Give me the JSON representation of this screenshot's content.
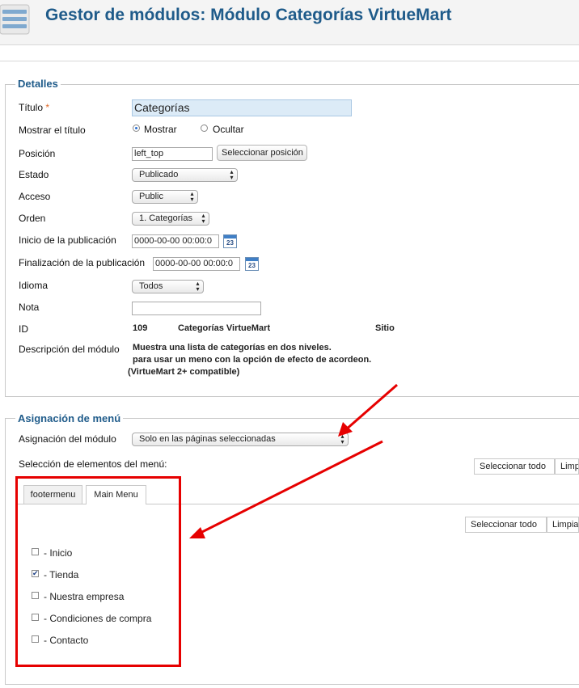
{
  "header": {
    "title": "Gestor de módulos: Módulo Categorías VirtueMart",
    "icon": "module-manager-icon"
  },
  "details": {
    "legend": "Detalles",
    "title_label": "Título",
    "required_mark": "*",
    "title_value": "Categorías",
    "show_title_label": "Mostrar el título",
    "show_title_options": [
      "Mostrar",
      "Ocultar"
    ],
    "show_title_selected": "Mostrar",
    "position_label": "Posición",
    "position_value": "left_top",
    "select_position_button": "Seleccionar posición",
    "status_label": "Estado",
    "status_value": "Publicado",
    "access_label": "Acceso",
    "access_value": "Public",
    "order_label": "Orden",
    "order_value": "1. Categorías",
    "publish_up_label": "Inicio de la publicación",
    "publish_up_value": "0000-00-00 00:00:0",
    "publish_down_label": "Finalización de la publicación",
    "publish_down_value": "0000-00-00 00:00:0",
    "calendar_day": "23",
    "language_label": "Idioma",
    "language_value": "Todos",
    "note_label": "Nota",
    "note_value": "",
    "id_label": "ID",
    "id_value": "109",
    "module_name": "Categorías VirtueMart",
    "module_site": "Sitio",
    "description_label": "Descripción del módulo",
    "description_lines": [
      "Muestra una lista de categorías en dos niveles.",
      "para usar un meno con la opción de efecto de acordeon.",
      "(VirtueMart 2+ compatible)"
    ]
  },
  "menu_assignment": {
    "legend": "Asignación de menú",
    "assignment_label": "Asignación del módulo",
    "assignment_value": "Solo en las páginas seleccionadas",
    "selection_label": "Selección de elementos del menú:",
    "select_all": "Seleccionar todo",
    "clear": "Limpiar",
    "tabs": [
      "footermenu",
      "Main Menu"
    ],
    "active_tab": "Main Menu",
    "items": [
      {
        "label": "- Inicio",
        "checked": false
      },
      {
        "label": "- Tienda",
        "checked": true
      },
      {
        "label": "- Nuestra empresa",
        "checked": false
      },
      {
        "label": "- Condiciones de compra",
        "checked": false
      },
      {
        "label": "- Contacto",
        "checked": false
      }
    ]
  },
  "colors": {
    "heading_blue": "#1f5b8a",
    "annotation_red": "#e60000",
    "title_input_bg": "#dcebf7"
  }
}
